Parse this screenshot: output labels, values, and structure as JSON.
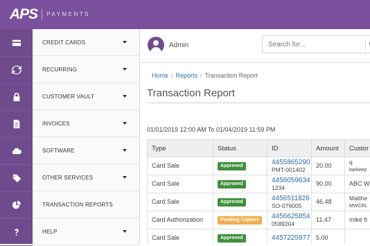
{
  "brand": {
    "logo_text": "APS",
    "subtitle": "PAYMENTS"
  },
  "colors": {
    "primary": "#7a4f9c",
    "sidebar_icons": "#6f4b8e",
    "approved": "#3f8f3b",
    "pending": "#f0ad4e",
    "link": "#2e6da4"
  },
  "sidebar": {
    "items": [
      {
        "label": "CREDIT CARDS",
        "icon": "credit-card-icon",
        "has_caret": true
      },
      {
        "label": "RECURRING",
        "icon": "refresh-icon",
        "has_caret": true
      },
      {
        "label": "CUSTOMER VAULT",
        "icon": "lock-icon",
        "has_caret": true
      },
      {
        "label": "INVOICES",
        "icon": "document-icon",
        "has_caret": true
      },
      {
        "label": "SOFTWARE",
        "icon": "cloud-icon",
        "has_caret": true
      },
      {
        "label": "OTHER SERVICES",
        "icon": "tag-icon",
        "has_caret": true
      },
      {
        "label": "TRANSACTION REPORTS",
        "icon": "pie-chart-icon",
        "has_caret": false
      },
      {
        "label": "HELP",
        "icon": "question-icon",
        "has_caret": true
      }
    ]
  },
  "header": {
    "user_name": "Admin",
    "search_placeholder": "Search for..."
  },
  "breadcrumb": {
    "items": [
      "Home",
      "Reports",
      "Transaction Report"
    ]
  },
  "page": {
    "title": "Transaction Report",
    "date_range": "01/01/2019 12:00 AM To 01/04/2019 11:59 PM"
  },
  "table": {
    "headers": [
      "Type",
      "Status",
      "ID",
      "Amount",
      "Custor"
    ],
    "rows": [
      {
        "type": "Card Sale",
        "status": "Approved",
        "status_kind": "approved",
        "id": "4455865290",
        "id_sub": "PMT-001402",
        "amount": "20.00",
        "customer": "q",
        "customer_sub": "barkeep"
      },
      {
        "type": "Card Sale",
        "status": "Approved",
        "status_kind": "approved",
        "id": "4456059634",
        "id_sub": "1234",
        "amount": "90.00",
        "customer": "ABC W",
        "customer_sub": ""
      },
      {
        "type": "Card Sale",
        "status": "Approved",
        "status_kind": "approved",
        "id": "4456511826",
        "id_sub": "SO-076005",
        "amount": "46.48",
        "customer": "Matthe",
        "customer_sub": "MWCRL"
      },
      {
        "type": "Card Authorization",
        "status": "Pending Capture",
        "status_kind": "pending",
        "id": "4456625854",
        "id_sub": "0589204",
        "amount": "11.47",
        "customer": "mike fi",
        "customer_sub": ""
      },
      {
        "type": "Card Sale",
        "status": "Approved",
        "status_kind": "approved",
        "id": "4457225977",
        "id_sub": "",
        "amount": "5.00",
        "customer": "",
        "customer_sub": ""
      }
    ]
  }
}
